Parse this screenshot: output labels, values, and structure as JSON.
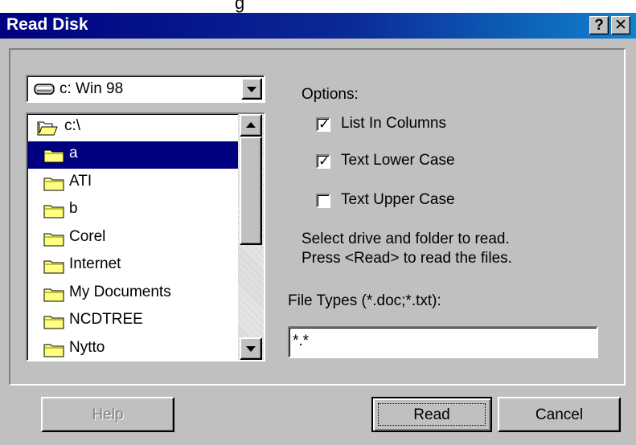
{
  "top_strip_text": "g",
  "window": {
    "title": "Read Disk",
    "help_glyph": "?",
    "close_glyph": "✕"
  },
  "drive": {
    "selected": "c: Win 98"
  },
  "folders": {
    "root": "c:\\",
    "items": [
      "a",
      "ATI",
      "b",
      "Corel",
      "Internet",
      "My Documents",
      "NCDTREE",
      "Nytto"
    ],
    "selected": "a"
  },
  "options": {
    "label": "Options:",
    "list_in_columns": {
      "label": "List In Columns",
      "checked": true
    },
    "text_lower_case": {
      "label": "Text Lower Case",
      "checked": true
    },
    "text_upper_case": {
      "label": "Text Upper Case",
      "checked": false
    }
  },
  "instructions": {
    "line1": "Select drive and folder to read.",
    "line2": "Press <Read> to read the files."
  },
  "file_types": {
    "label": "File Types (*.doc;*.txt):",
    "value": "*.*"
  },
  "buttons": {
    "help": "Help",
    "read": "Read",
    "cancel": "Cancel"
  },
  "colors": {
    "title_start": "#000080",
    "title_end": "#1084d0",
    "selection": "#000080",
    "face": "#c0c0c0"
  }
}
